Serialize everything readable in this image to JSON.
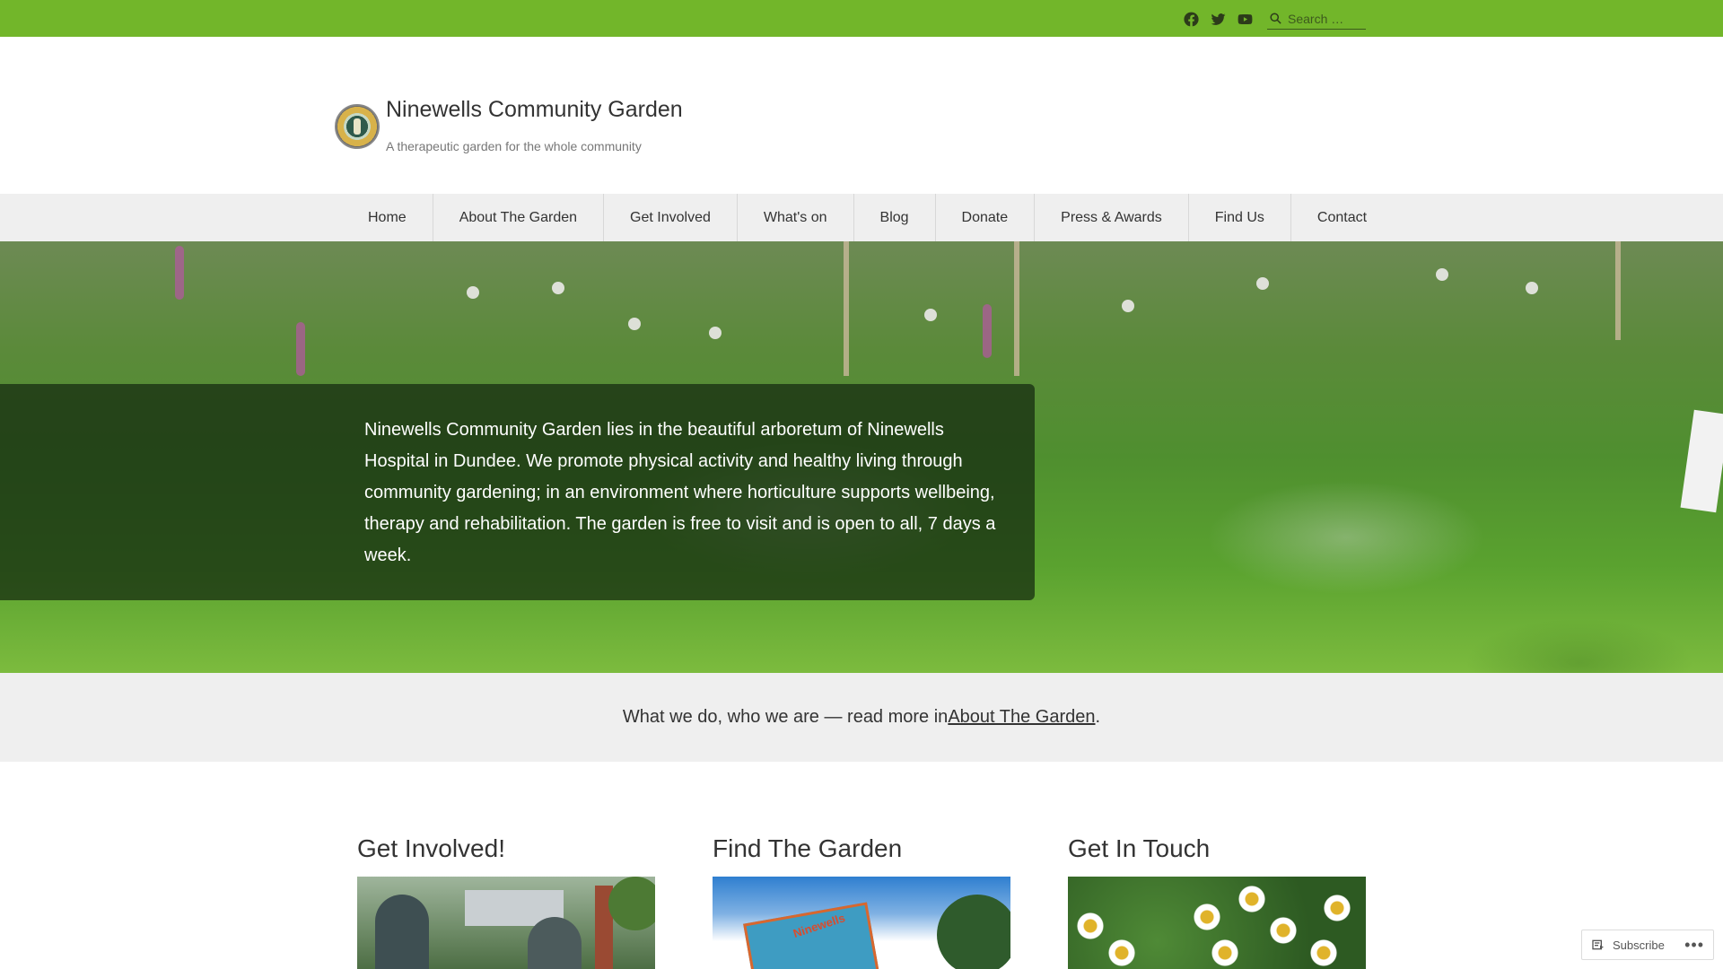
{
  "topbar": {
    "bg_color": "#72b62a",
    "social": [
      {
        "name": "facebook-icon"
      },
      {
        "name": "twitter-icon"
      },
      {
        "name": "youtube-icon"
      }
    ],
    "search": {
      "placeholder": "Search …"
    }
  },
  "header": {
    "title": "Ninewells Community Garden",
    "tagline": "A therapeutic garden for the whole community"
  },
  "nav": {
    "items": [
      {
        "label": "Home"
      },
      {
        "label": "About The Garden"
      },
      {
        "label": "Get Involved"
      },
      {
        "label": "What's on"
      },
      {
        "label": "Blog"
      },
      {
        "label": "Donate"
      },
      {
        "label": "Press & Awards"
      },
      {
        "label": "Find Us"
      },
      {
        "label": "Contact"
      }
    ]
  },
  "hero": {
    "text": "Ninewells Community Garden lies in the beautiful arboretum of Ninewells Hospital in Dundee. We promote physical activity and healthy living through community gardening; in an environment where horticulture supports wellbeing, therapy and rehabilitation. The garden is free to visit and is open to all, 7 days a week."
  },
  "intro": {
    "text_before": "What we do, who we are — read more in ",
    "link": "About The Garden",
    "text_after": "."
  },
  "cards": [
    {
      "title": "Get Involved!"
    },
    {
      "title": "Find The Garden",
      "image_text": "Ninewells"
    },
    {
      "title": "Get In Touch"
    }
  ],
  "subscribe": {
    "label": "Subscribe",
    "more": "•••"
  }
}
